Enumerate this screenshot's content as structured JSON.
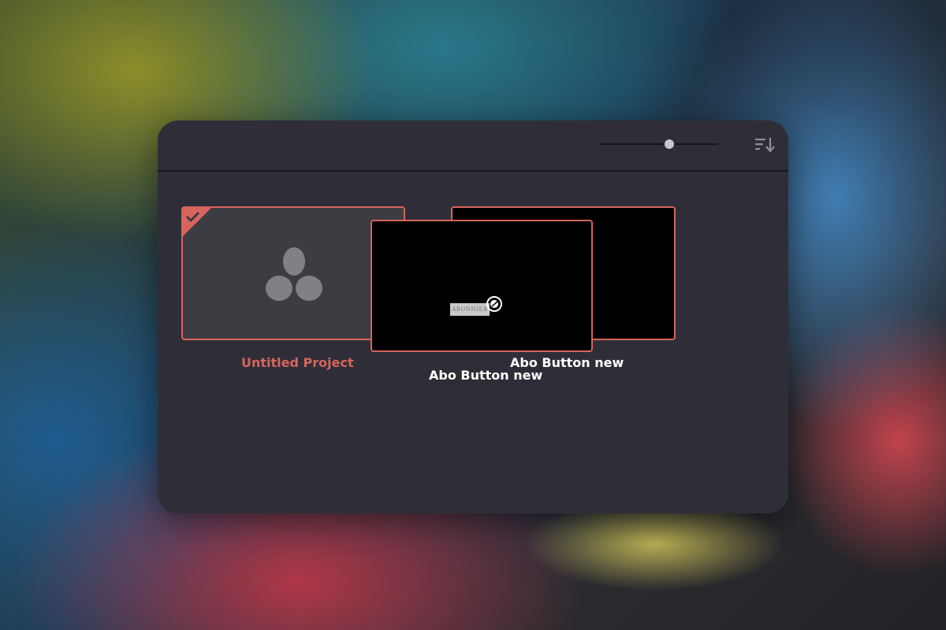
{
  "toolbar": {
    "zoom_level": 0.59,
    "sort_icon": "sort-descending-icon"
  },
  "projects": [
    {
      "title": "Untitled Project",
      "selected": true,
      "thumbnail_icon": "davinci-resolve-logo-icon",
      "badge_icon": "checkmark-icon"
    },
    {
      "title": "Abo Button new",
      "selected": true,
      "thumbnail_button_text": "ABONNIER"
    },
    {
      "title": "Abo Button new",
      "selected": true
    }
  ],
  "colors": {
    "panel_bg": "#2f2e38",
    "accent": "#d8645c",
    "divider": "#17161c",
    "thumbnail_empty_bg": "#3c3c42"
  }
}
